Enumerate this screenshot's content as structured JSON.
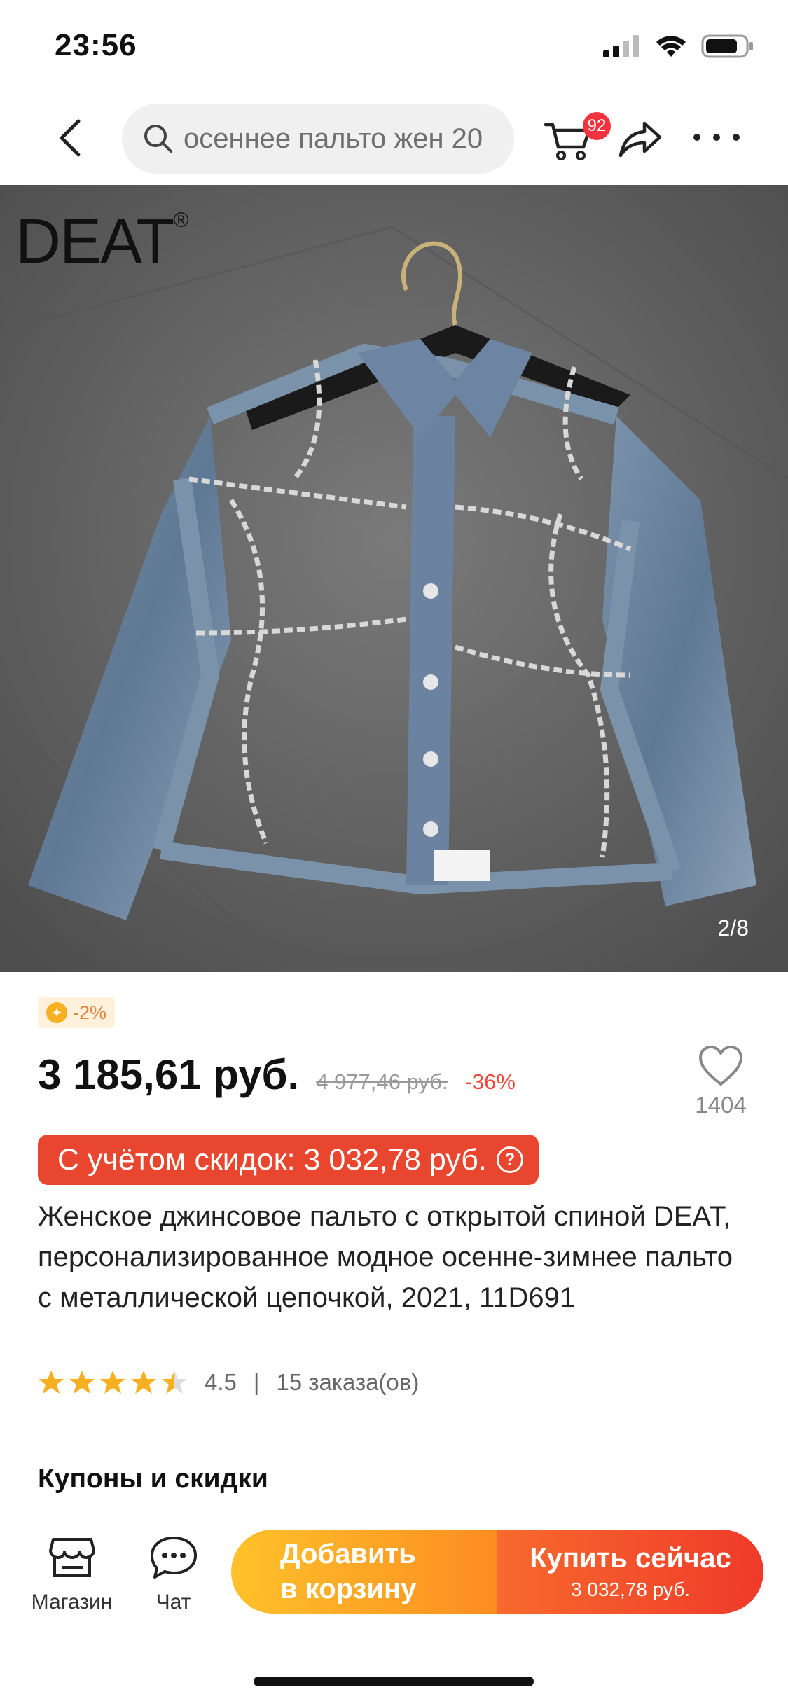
{
  "status_bar": {
    "time": "23:56"
  },
  "nav": {
    "search_text": "осеннее пальто жен 20",
    "cart_badge": "92"
  },
  "gallery": {
    "brand_logo": "DEAT",
    "brand_mark": "®",
    "counter": "2/8"
  },
  "price": {
    "coin_discount": "-2%",
    "current": "3 185,61 руб.",
    "old": "4 977,46 руб.",
    "discount_pct": "-36%",
    "with_discounts": "С учётом скидок: 3 032,78 руб.",
    "info_icon": "?"
  },
  "wishlist": {
    "count": "1404"
  },
  "product": {
    "title": "Женское джинсовое пальто с открытой спиной DEAT, персонализированное модное осенне-зимнее пальто с металлической цепочкой, 2021, 11D691"
  },
  "rating": {
    "value": "4.5",
    "stars": 4.5,
    "separator": "|",
    "orders": "15 заказа(ов)"
  },
  "sections": {
    "coupons_title": "Купоны и скидки"
  },
  "bottom_bar": {
    "store_label": "Магазин",
    "chat_label": "Чат",
    "add_to_cart_line1": "Добавить",
    "add_to_cart_line2": "в корзину",
    "buy_now_label": "Купить сейчас",
    "buy_now_price": "3 032,78 руб."
  },
  "colors": {
    "accent_red": "#e8462e",
    "badge_red": "#f5333f",
    "cart_button_from": "#ffc22b",
    "cart_button_to": "#fd8c20",
    "buy_button_from": "#f76a2d",
    "buy_button_to": "#ef3a2a",
    "star": "#f8b021"
  },
  "icons": [
    "signal-icon",
    "wifi-icon",
    "battery-icon",
    "back-arrow-icon",
    "search-icon",
    "cart-icon",
    "share-icon",
    "more-icon",
    "coin-icon",
    "heart-icon",
    "star-icon",
    "store-icon",
    "chat-icon"
  ]
}
